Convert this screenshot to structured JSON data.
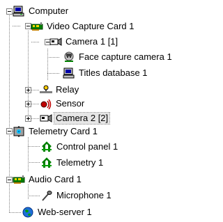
{
  "tree": {
    "nodes": [
      {
        "label": "Computer",
        "icon": "computer-icon",
        "expander": "minus"
      },
      {
        "label": "Video Capture Card 1",
        "icon": "capture-card-icon",
        "expander": "minus"
      },
      {
        "label": "Camera 1 [1]",
        "icon": "camera-icon",
        "expander": "minus"
      },
      {
        "label": "Face capture camera 1",
        "icon": "face-capture-icon",
        "expander": "none"
      },
      {
        "label": "Titles database 1",
        "icon": "titles-database-icon",
        "expander": "none"
      },
      {
        "label": "Relay",
        "icon": "relay-icon",
        "expander": "plus"
      },
      {
        "label": "Sensor",
        "icon": "sensor-icon",
        "expander": "plus"
      },
      {
        "label": "Camera 2 [2]",
        "icon": "camera-icon",
        "expander": "plus",
        "selected": true
      },
      {
        "label": "Telemetry Card 1",
        "icon": "telemetry-card-icon",
        "expander": "minus"
      },
      {
        "label": "Control panel 1",
        "icon": "control-panel-icon",
        "expander": "none"
      },
      {
        "label": "Telemetry 1",
        "icon": "telemetry-icon",
        "expander": "none"
      },
      {
        "label": "Audio Card 1",
        "icon": "audio-card-icon",
        "expander": "minus"
      },
      {
        "label": "Microphone 1",
        "icon": "microphone-icon",
        "expander": "none"
      },
      {
        "label": "Web-server 1",
        "icon": "web-server-icon",
        "expander": "none"
      }
    ]
  }
}
